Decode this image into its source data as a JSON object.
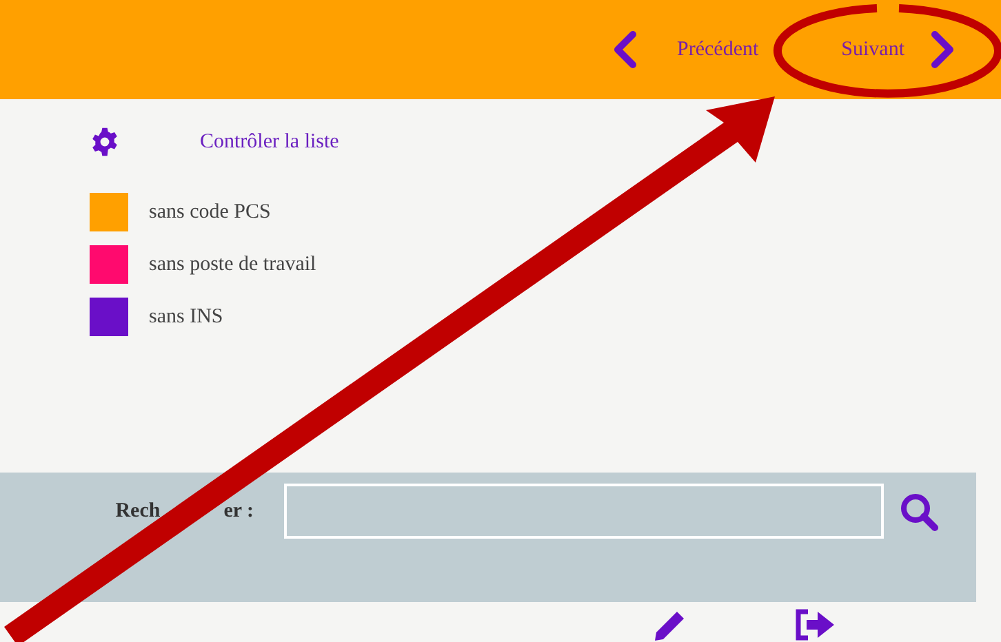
{
  "nav": {
    "previous": "Précédent",
    "next": "Suivant"
  },
  "list_control": {
    "label": "Contrôler la liste"
  },
  "legend": [
    {
      "label": "sans code PCS",
      "color": "#ffa000"
    },
    {
      "label": "sans poste de travail",
      "color": "#ff0a6e"
    },
    {
      "label": "sans INS",
      "color": "#6a0fc8"
    }
  ],
  "search": {
    "label_parts": [
      "Rech",
      "er :"
    ]
  }
}
